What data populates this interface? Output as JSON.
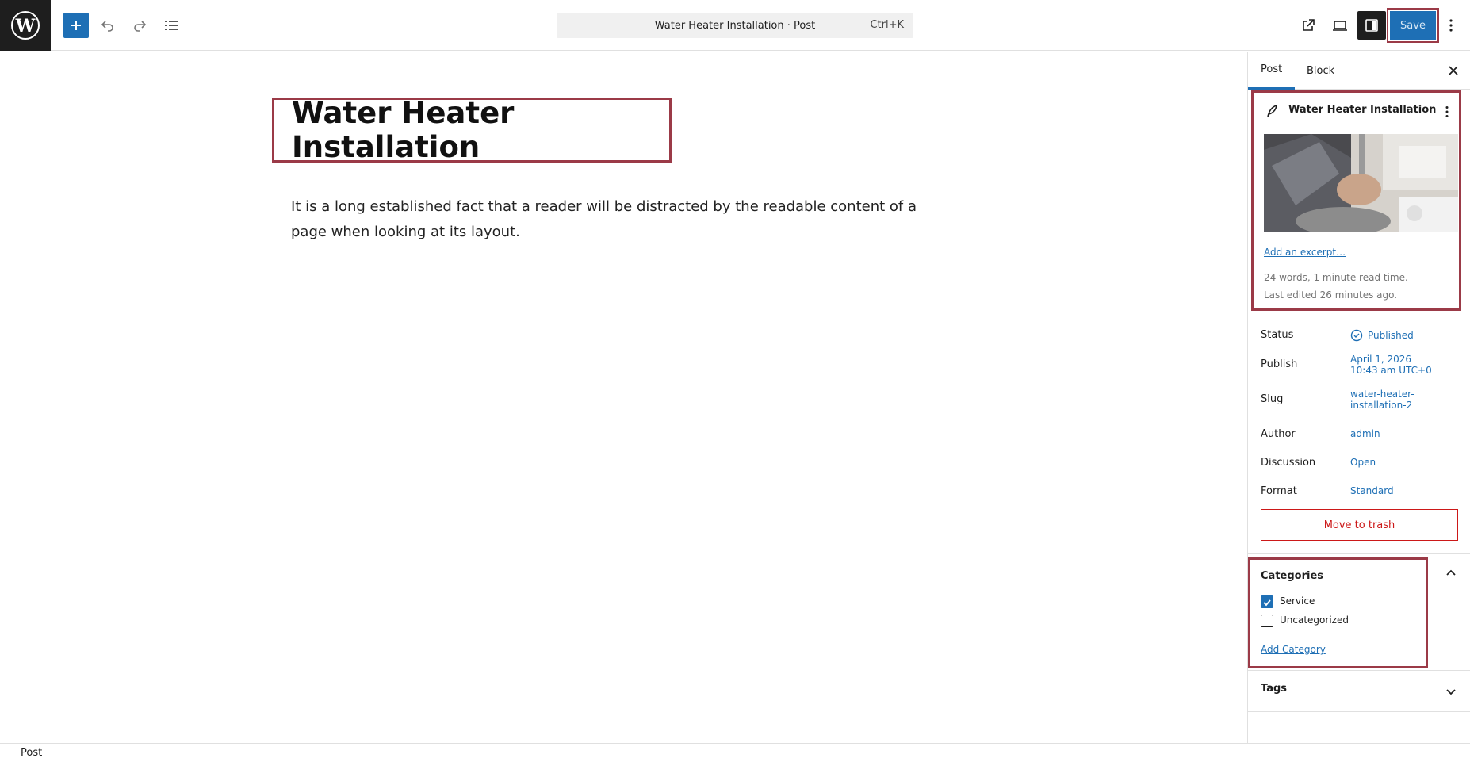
{
  "header": {
    "command_title": "Water Heater Installation · Post",
    "command_shortcut": "Ctrl+K",
    "save_label": "Save",
    "icons": [
      "wordpress-icon",
      "plus-icon",
      "undo-icon",
      "redo-icon",
      "list-view-icon",
      "external-link-icon",
      "desktop-preview-icon",
      "settings-icon",
      "more-options-icon"
    ]
  },
  "editor": {
    "title": "Water Heater Installation",
    "paragraph": "It is a long established fact that a reader will be distracted by the readable content of a page when looking at its layout."
  },
  "sidebar": {
    "tabs": [
      "Post",
      "Block"
    ],
    "card": {
      "title": "Water Heater Installation",
      "excerpt_link": "Add an excerpt…",
      "stats": "24 words, 1 minute read time.",
      "last_edited": "Last edited 26 minutes ago."
    },
    "fields": {
      "status_label": "Status",
      "status_value": "Published",
      "publish_label": "Publish",
      "publish_date": "April 1, 2026",
      "publish_time": "10:43 am UTC+0",
      "slug_label": "Slug",
      "slug_line1": "water-heater-",
      "slug_line2": "installation-2",
      "author_label": "Author",
      "author_value": "admin",
      "discussion_label": "Discussion",
      "discussion_value": "Open",
      "format_label": "Format",
      "format_value": "Standard"
    },
    "trash_label": "Move to trash",
    "categories": {
      "heading": "Categories",
      "items": [
        {
          "label": "Service",
          "checked": true
        },
        {
          "label": "Uncategorized",
          "checked": false
        }
      ],
      "add_link": "Add Category"
    },
    "tags_heading": "Tags"
  },
  "footer": {
    "breadcrumb": "Post"
  },
  "colors": {
    "accent": "#1e6fb5",
    "highlight_border": "#9b3a47",
    "danger": "#cc1818"
  }
}
